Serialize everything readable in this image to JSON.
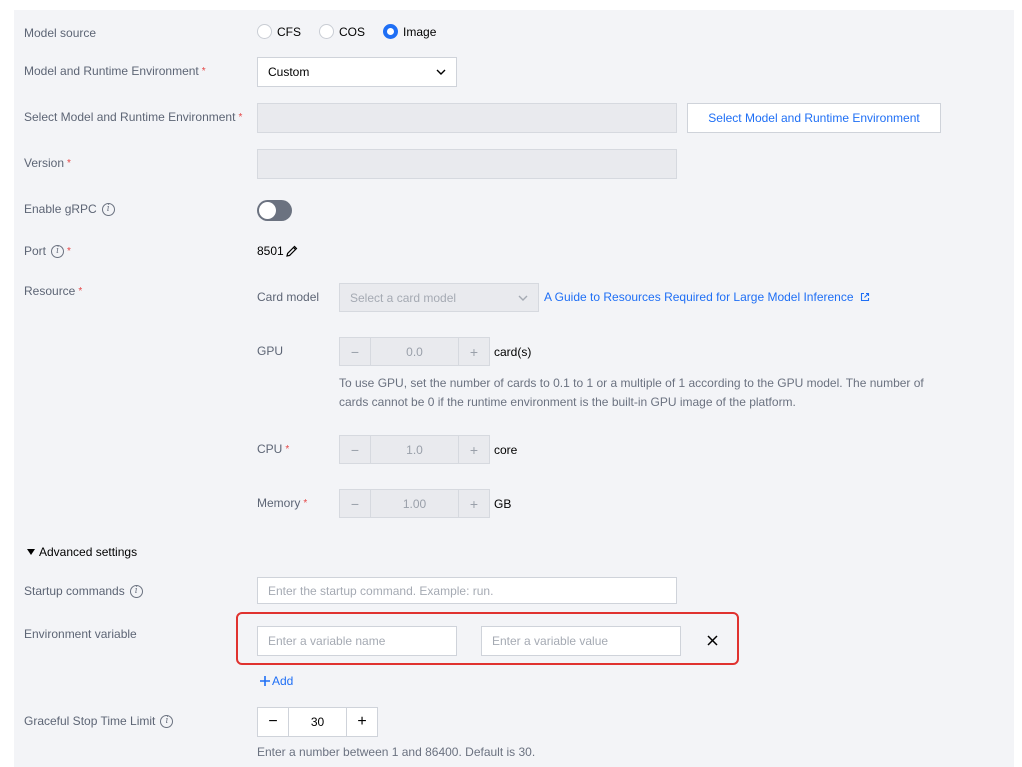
{
  "model_source": {
    "label": "Model source",
    "options": [
      {
        "label": "CFS",
        "selected": false
      },
      {
        "label": "COS",
        "selected": false
      },
      {
        "label": "Image",
        "selected": true
      }
    ]
  },
  "model_env": {
    "label": "Model and Runtime Environment",
    "value": "Custom"
  },
  "select_env": {
    "label": "Select Model and Runtime Environment",
    "button_label": "Select Model and Runtime Environment"
  },
  "version": {
    "label": "Version"
  },
  "grpc": {
    "label": "Enable gRPC",
    "enabled": false
  },
  "port": {
    "label": "Port",
    "value": "8501"
  },
  "resource": {
    "label": "Resource",
    "card_model_label": "Card model",
    "card_model_placeholder": "Select a card model",
    "guide_link": "A Guide to Resources Required for Large Model Inference",
    "gpu": {
      "label": "GPU",
      "value": "0.0",
      "unit": "card(s)",
      "hint": "To use GPU, set the number of cards to 0.1 to 1 or a multiple of 1 according to the GPU model. The number of cards cannot be 0 if the runtime environment is the built-in GPU image of the platform."
    },
    "cpu": {
      "label": "CPU",
      "value": "1.0",
      "unit": "core"
    },
    "memory": {
      "label": "Memory",
      "value": "1.00",
      "unit": "GB"
    }
  },
  "advanced": {
    "toggle_label": "Advanced settings",
    "startup_label": "Startup commands",
    "startup_placeholder": "Enter the startup command. Example: run.",
    "env_label": "Environment variable",
    "env_name_placeholder": "Enter a variable name",
    "env_value_placeholder": "Enter a variable value",
    "add_label": "Add",
    "graceful_label": "Graceful Stop Time Limit",
    "graceful_value": "30",
    "graceful_hint": "Enter a number between 1 and 86400. Default is 30."
  },
  "colors": {
    "accent": "#1f6ff5",
    "required": "#e54545",
    "highlight": "#e0322f"
  }
}
